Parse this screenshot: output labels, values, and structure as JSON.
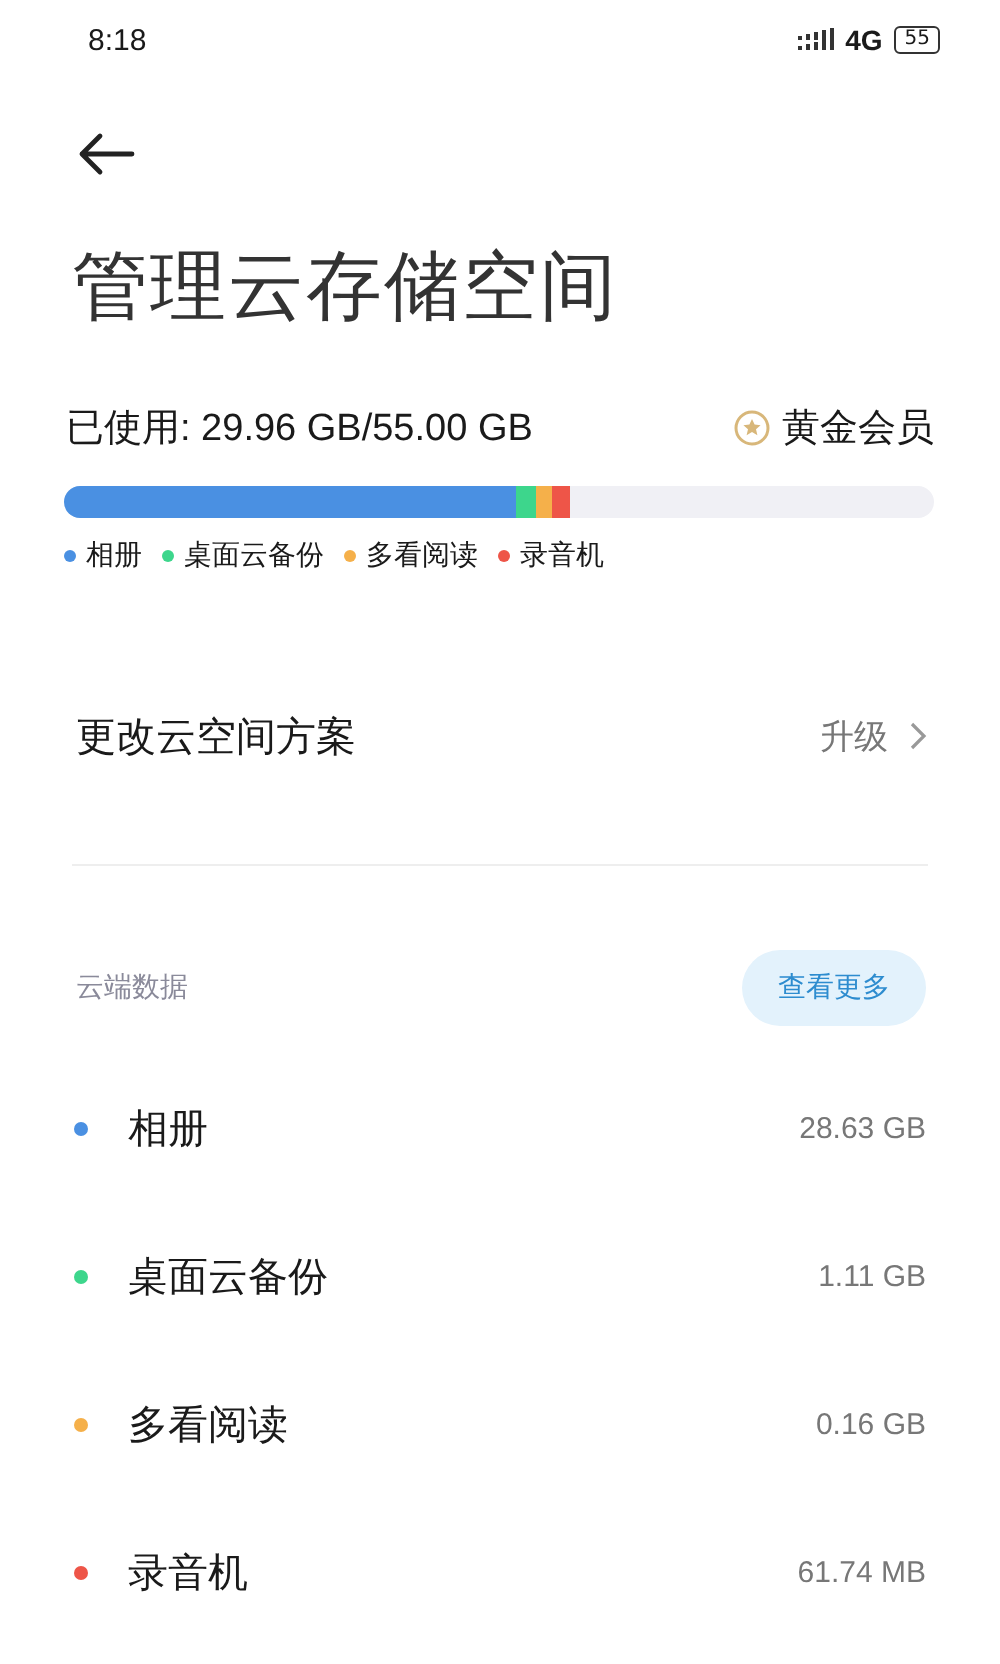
{
  "status_bar": {
    "time": "8:18",
    "network": "4G",
    "battery": "55"
  },
  "title": "管理云存储空间",
  "usage": {
    "text": "已使用: 29.96 GB/55.00 GB",
    "membership": "黄金会员"
  },
  "storage_bar": [
    {
      "color": "#4a90e2",
      "level": 0.52
    },
    {
      "color": "#3dd68c"
    },
    {
      "color": "#f5b04a"
    },
    {
      "color": "#ee5548"
    }
  ],
  "legend": [
    {
      "name": "相册",
      "color": "#4a90e2"
    },
    {
      "name": "桌面云备份",
      "color": "#3dd68c"
    },
    {
      "name": "多看阅读",
      "color": "#f5b04a"
    },
    {
      "name": "录音机",
      "color": "#ee5548"
    }
  ],
  "plan": {
    "label": "更改云空间方案",
    "action": "升级"
  },
  "cloud_data": {
    "header": "云端数据",
    "more_button": "查看更多",
    "items": [
      {
        "name": "相册",
        "size": "28.63 GB",
        "color": "#4a90e2"
      },
      {
        "name": "桌面云备份",
        "size": "1.11 GB",
        "color": "#3dd68c"
      },
      {
        "name": "多看阅读",
        "size": "0.16 GB",
        "color": "#f5b04a"
      },
      {
        "name": "录音机",
        "size": "61.74 MB",
        "color": "#ee5548"
      }
    ]
  }
}
